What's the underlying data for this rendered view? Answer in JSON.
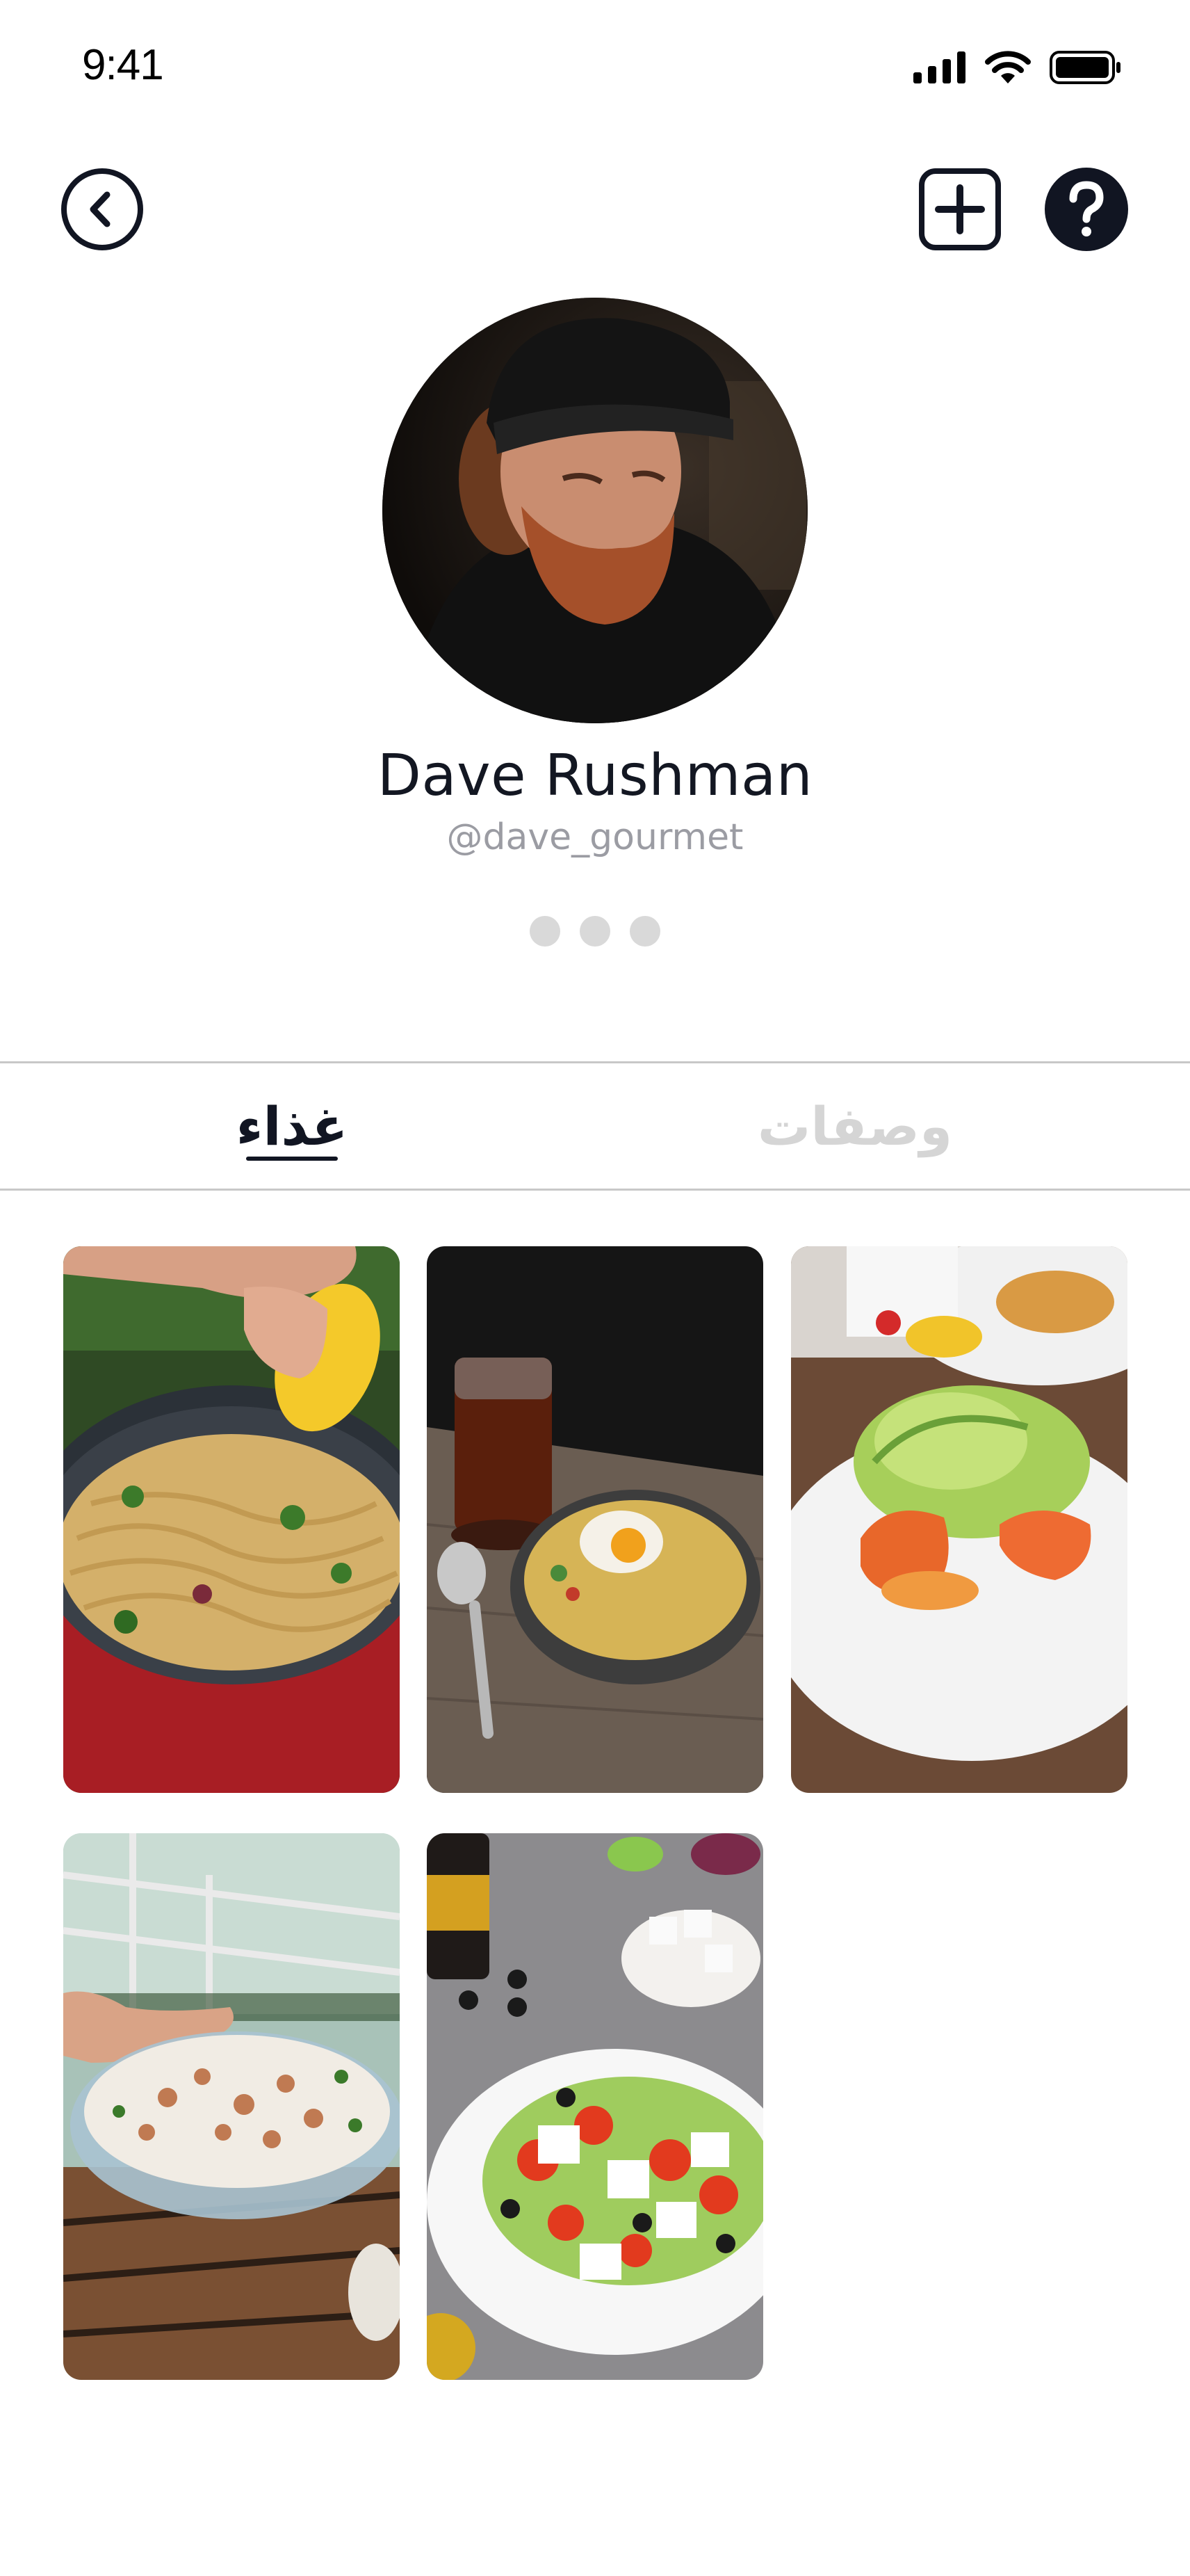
{
  "status_bar": {
    "time": "9:41",
    "icons": [
      "signal-icon",
      "wifi-icon",
      "battery-icon"
    ]
  },
  "header": {
    "back_icon": "chevron-left-circle-icon",
    "add_icon": "plus-square-icon",
    "help_icon": "question-circle-icon"
  },
  "profile": {
    "name": "Dave Rushman",
    "handle": "@dave_gourmet",
    "avatar": "avatar-photo",
    "more_icon": "more-dots-icon"
  },
  "tabs": [
    {
      "label": "غذاء",
      "active": true
    },
    {
      "label": "وصفات",
      "active": false
    }
  ],
  "colors": {
    "text_primary": "#111522",
    "text_secondary": "#9b9ca3",
    "tab_inactive": "#d5d5d5",
    "divider": "#c8c8c8",
    "dots": "#d9d9d9"
  },
  "photos": [
    {
      "subject": "pasta-pan-lemon-photo"
    },
    {
      "subject": "egg-noodle-bowl-photo"
    },
    {
      "subject": "salmon-salad-plate-photo"
    },
    {
      "subject": "rice-salad-bowl-photo"
    },
    {
      "subject": "greek-salad-plate-photo"
    }
  ]
}
